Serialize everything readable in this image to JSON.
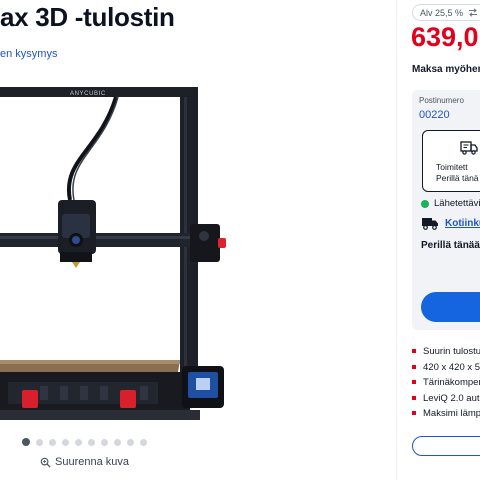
{
  "product": {
    "title": "ax 3D -tulostin",
    "qa_link": "en kysymys",
    "brand_text": "ANYCUBIC"
  },
  "gallery": {
    "dots_count": 10,
    "active_index": 0,
    "zoom_label": "Suurenna kuva"
  },
  "pricing": {
    "discount": "Alv 25,5 %",
    "price": "639,0",
    "pay_later": "Maksa myöhem"
  },
  "delivery": {
    "postal_label": "Postinumero",
    "postal_value": "00220",
    "pickup_title": "Toimitett",
    "pickup_sub": "Perillä tänä",
    "stock_text": "Lähetettävis",
    "home_delivery": "Kotiinku",
    "arrive_text": "Perillä tänään"
  },
  "features": [
    "Suurin tulostu",
    "420 x 420 x 5",
    "Tärinäkomper",
    "LeviQ 2.0 aut",
    "Maksimi lämp"
  ],
  "colors": {
    "price_red": "#e3001b",
    "link_blue": "#1e55c9",
    "button_blue": "#1565e0",
    "stock_green": "#19b15a"
  }
}
